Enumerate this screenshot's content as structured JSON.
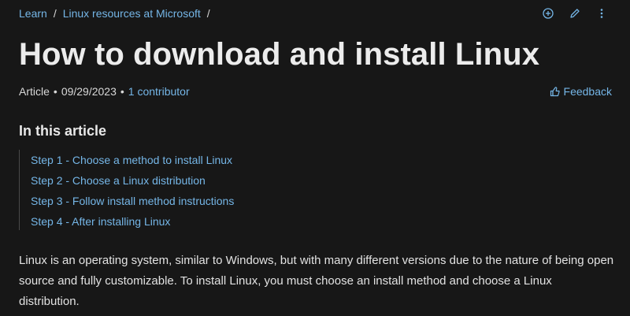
{
  "breadcrumb": {
    "items": [
      "Learn",
      "Linux resources at Microsoft"
    ],
    "separator": "/"
  },
  "actions": {
    "icons": [
      "add-circle-icon",
      "edit-icon",
      "more-vertical-icon"
    ]
  },
  "article": {
    "title": "How to download and install Linux",
    "type": "Article",
    "date": "09/29/2023",
    "contributors": "1 contributor",
    "meta_dot": "•"
  },
  "feedback": {
    "label": "Feedback",
    "icon": "thumbs-up-icon"
  },
  "toc": {
    "heading": "In this article",
    "items": [
      "Step 1 - Choose a method to install Linux",
      "Step 2 - Choose a Linux distribution",
      "Step 3 - Follow install method instructions",
      "Step 4 - After installing Linux"
    ]
  },
  "body": {
    "paragraph": "Linux is an operating system, similar to Windows, but with many different versions due to the nature of being open source and fully customizable. To install Linux, you must choose an install method and choose a Linux distribution."
  },
  "colors": {
    "background": "#171717",
    "link": "#75b6e7",
    "text": "#e6e6e6"
  }
}
